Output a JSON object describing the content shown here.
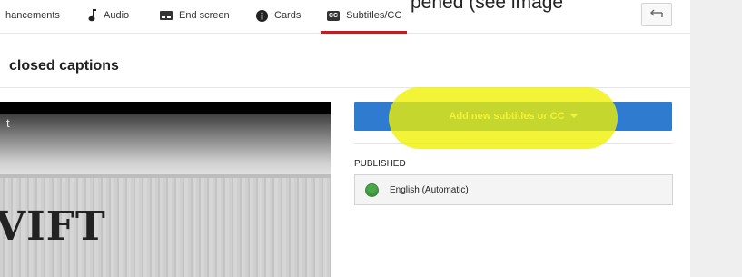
{
  "overlay_text": "pened (see image",
  "tabs": [
    {
      "label": "hancements",
      "icon": "enhancements-icon"
    },
    {
      "label": "Audio",
      "icon": "music-note-icon"
    },
    {
      "label": "End screen",
      "icon": "end-screen-icon"
    },
    {
      "label": "Cards",
      "icon": "info-icon"
    },
    {
      "label": "Subtitles/CC",
      "icon": "cc-icon",
      "active": true
    }
  ],
  "cc_icon_text": "CC",
  "header": {
    "title": "closed captions"
  },
  "video": {
    "visible_text": "VIFT",
    "corner_text": "t"
  },
  "add_button": {
    "label": "Add new subtitles or CC",
    "color": "#2e7bcf"
  },
  "published": {
    "section_label": "PUBLISHED",
    "tracks": [
      {
        "label": "English (Automatic)",
        "status_color": "#4aa84a"
      }
    ]
  },
  "highlight_color": "#f0f000",
  "active_tab_color": "#cc181e"
}
